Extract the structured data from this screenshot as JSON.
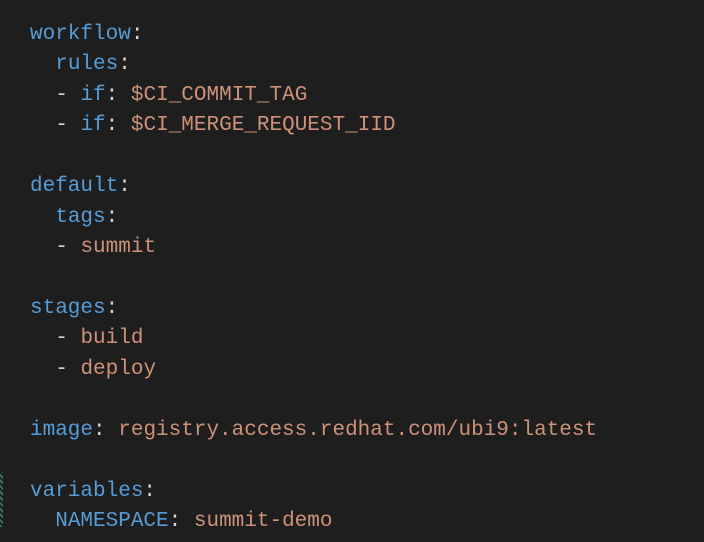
{
  "yaml": {
    "workflow": {
      "key": "workflow",
      "rules": {
        "key": "rules",
        "items": [
          {
            "dash": "- ",
            "ifkey": "if",
            "val": "$CI_COMMIT_TAG"
          },
          {
            "dash": "- ",
            "ifkey": "if",
            "val": "$CI_MERGE_REQUEST_IID"
          }
        ]
      }
    },
    "default": {
      "key": "default",
      "tags": {
        "key": "tags",
        "items": [
          {
            "dash": "- ",
            "val": "summit"
          }
        ]
      }
    },
    "stages": {
      "key": "stages",
      "items": [
        {
          "dash": "- ",
          "val": "build"
        },
        {
          "dash": "- ",
          "val": "deploy"
        }
      ]
    },
    "image": {
      "key": "image",
      "val": "registry.access.redhat.com/ubi9:latest"
    },
    "variables": {
      "key": "variables",
      "namespace": {
        "key": "NAMESPACE",
        "val": "summit-demo"
      }
    }
  },
  "punct": {
    "colon": ":",
    "colon_sp": ": ",
    "dash": "- "
  },
  "indent": {
    "s2": "  ",
    "s4": "    "
  }
}
